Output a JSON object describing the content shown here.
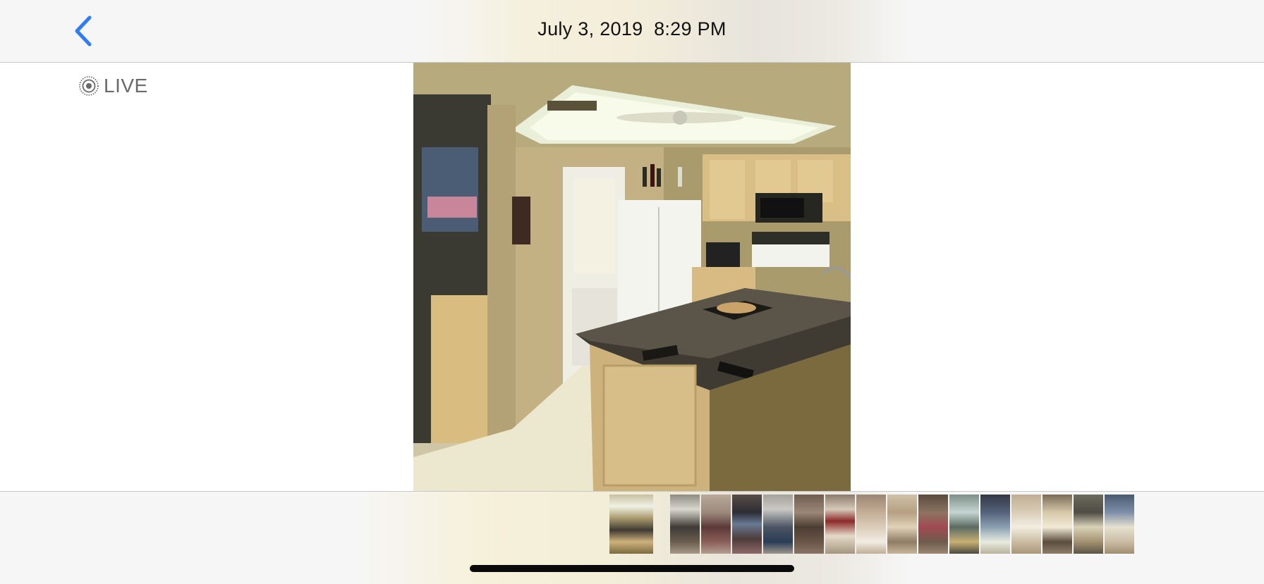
{
  "header": {
    "title": "July 3, 2019  8:29 PM",
    "back_icon": "chevron-left-icon",
    "accent_color": "#2f7cf6"
  },
  "live_badge": {
    "label": "LIVE",
    "icon": "live-photo-icon"
  },
  "photo": {
    "subject": "kitchen-photo"
  },
  "thumbnails": [
    {
      "name": "kitchen",
      "current": true
    },
    {
      "name": "living-room-1"
    },
    {
      "name": "living-room-2"
    },
    {
      "name": "dining-room"
    },
    {
      "name": "bedroom-chair"
    },
    {
      "name": "bedroom-dresser"
    },
    {
      "name": "hallway-shelves"
    },
    {
      "name": "bathroom-toilet"
    },
    {
      "name": "vanity"
    },
    {
      "name": "living-room-3"
    },
    {
      "name": "kitchen-2"
    },
    {
      "name": "kitchen-3"
    },
    {
      "name": "bathroom-2"
    },
    {
      "name": "bathroom-vanity"
    },
    {
      "name": "bedroom-mirror"
    },
    {
      "name": "bedroom-bed"
    }
  ]
}
